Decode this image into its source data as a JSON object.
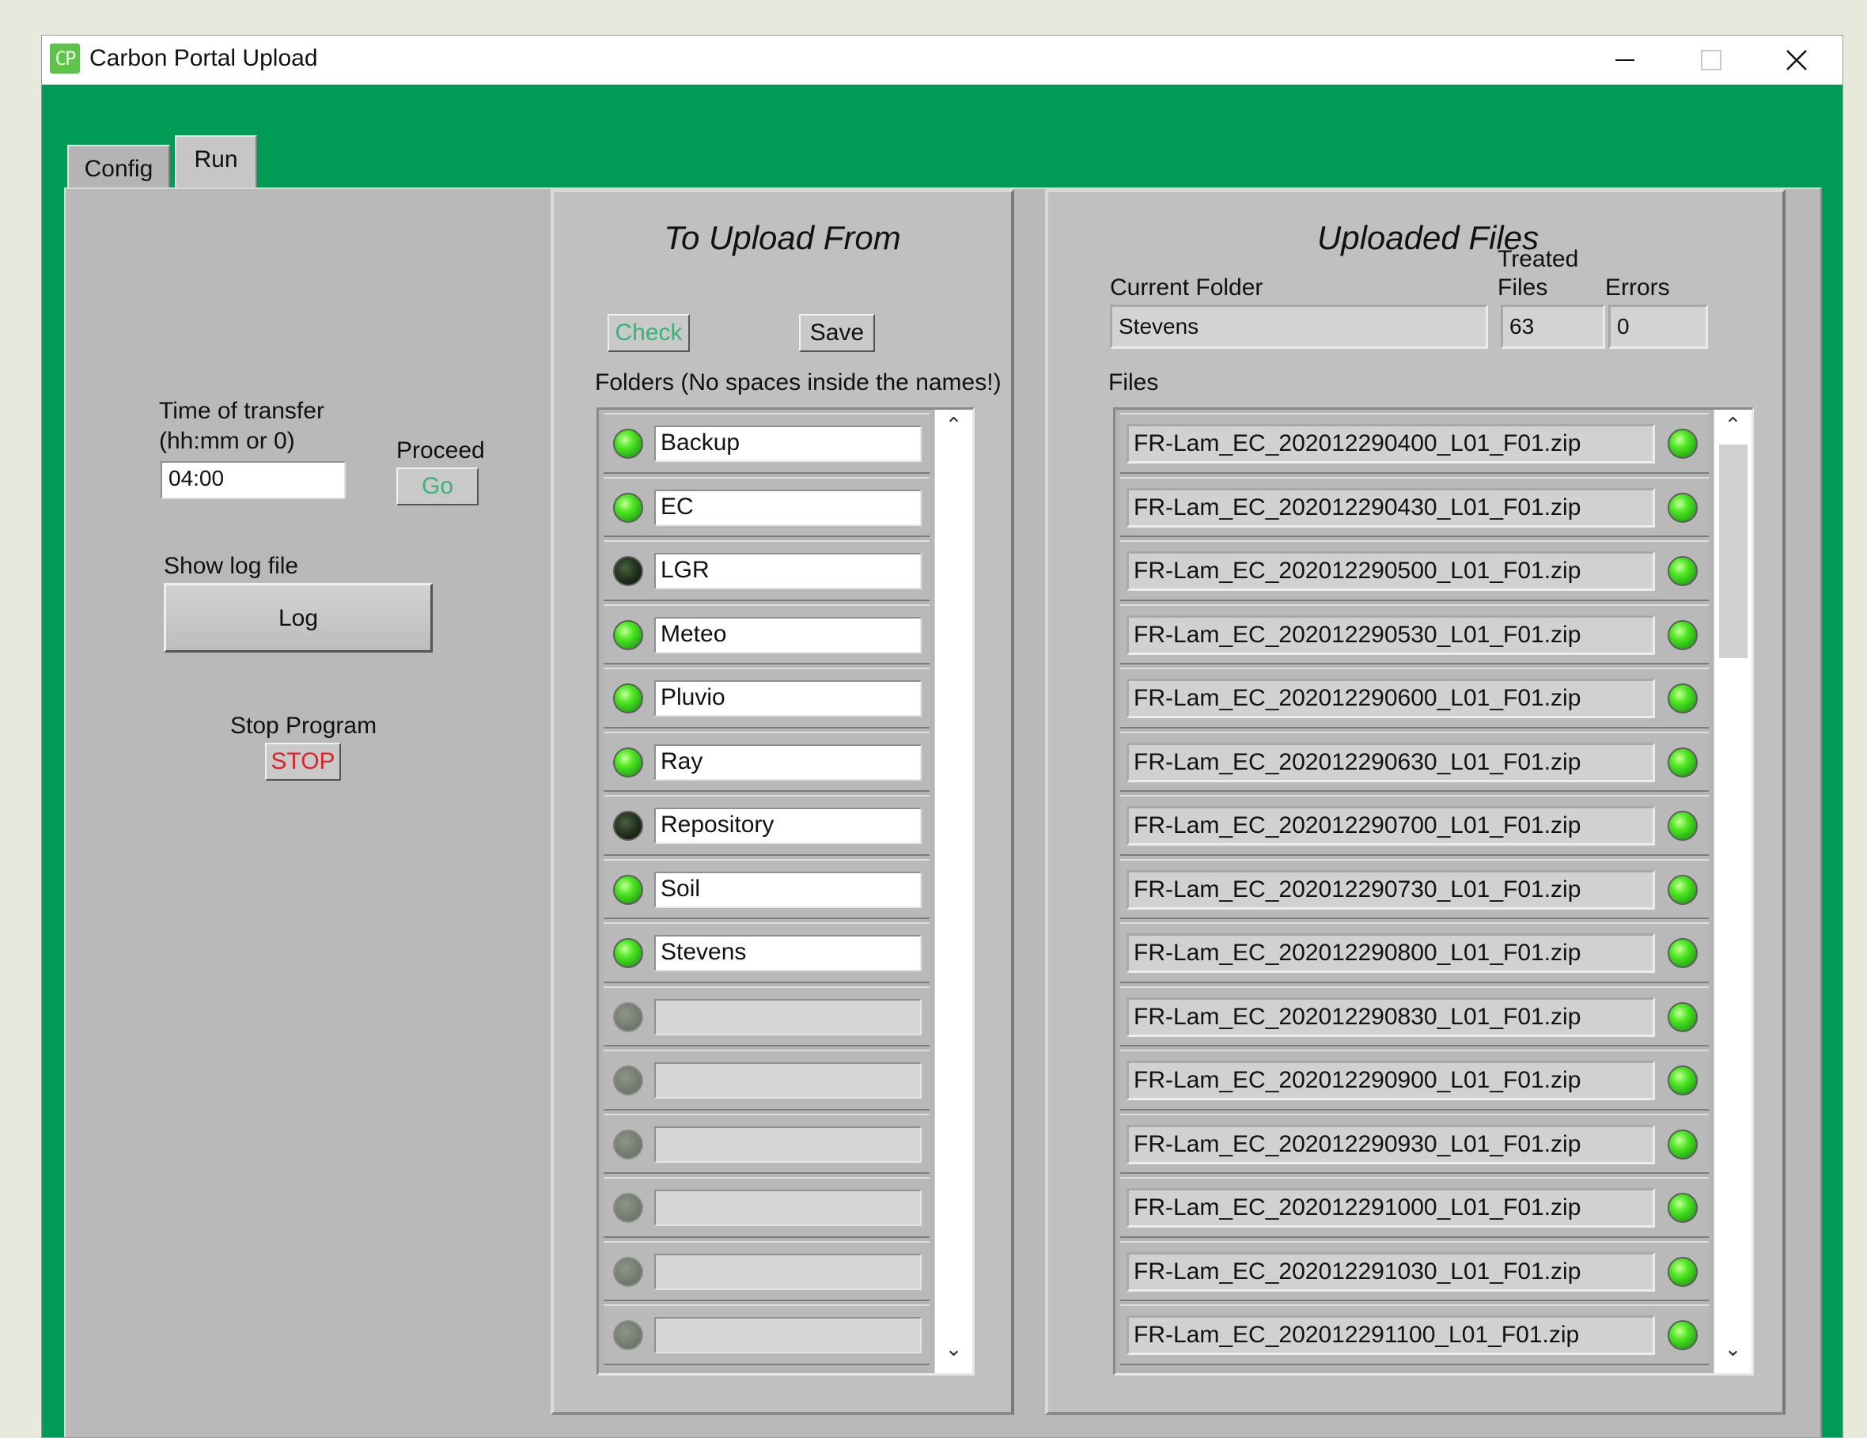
{
  "window": {
    "title": "Carbon Portal Upload",
    "icon_text": "CP",
    "accent": "#009b55"
  },
  "tabs": [
    {
      "label": "Config",
      "active": false
    },
    {
      "label": "Run",
      "active": true
    }
  ],
  "left": {
    "time_label_1": "Time of transfer",
    "time_label_2": "(hh:mm or 0)",
    "time_value": "04:00",
    "proceed_label": "Proceed",
    "go_label": "Go",
    "log_label": "Show log file",
    "log_button": "Log",
    "stop_label": "Stop Program",
    "stop_button": "STOP"
  },
  "upload_from": {
    "title": "To Upload From",
    "check_label": "Check",
    "save_label": "Save",
    "folders_label": "Folders (No spaces inside the names!)",
    "folders": [
      {
        "name": "Backup",
        "status": "on"
      },
      {
        "name": "EC",
        "status": "on"
      },
      {
        "name": "LGR",
        "status": "off"
      },
      {
        "name": "Meteo",
        "status": "on"
      },
      {
        "name": "Pluvio",
        "status": "on"
      },
      {
        "name": "Ray",
        "status": "on"
      },
      {
        "name": "Repository",
        "status": "off"
      },
      {
        "name": "Soil",
        "status": "on"
      },
      {
        "name": "Stevens",
        "status": "on"
      },
      {
        "name": "",
        "status": "empty"
      },
      {
        "name": "",
        "status": "empty"
      },
      {
        "name": "",
        "status": "empty"
      },
      {
        "name": "",
        "status": "empty"
      },
      {
        "name": "",
        "status": "empty"
      },
      {
        "name": "",
        "status": "empty"
      }
    ]
  },
  "uploaded": {
    "title": "Uploaded Files",
    "current_folder_label": "Current Folder",
    "current_folder": "Stevens",
    "treated_label_1": "Treated",
    "treated_label_2": "Files",
    "treated_value": "63",
    "errors_label": "Errors",
    "errors_value": "0",
    "files_label": "Files",
    "files": [
      "FR-Lam_EC_202012290400_L01_F01.zip",
      "FR-Lam_EC_202012290430_L01_F01.zip",
      "FR-Lam_EC_202012290500_L01_F01.zip",
      "FR-Lam_EC_202012290530_L01_F01.zip",
      "FR-Lam_EC_202012290600_L01_F01.zip",
      "FR-Lam_EC_202012290630_L01_F01.zip",
      "FR-Lam_EC_202012290700_L01_F01.zip",
      "FR-Lam_EC_202012290730_L01_F01.zip",
      "FR-Lam_EC_202012290800_L01_F01.zip",
      "FR-Lam_EC_202012290830_L01_F01.zip",
      "FR-Lam_EC_202012290900_L01_F01.zip",
      "FR-Lam_EC_202012290930_L01_F01.zip",
      "FR-Lam_EC_202012291000_L01_F01.zip",
      "FR-Lam_EC_202012291030_L01_F01.zip",
      "FR-Lam_EC_202012291100_L01_F01.zip"
    ]
  },
  "icons": {
    "minimize": "minimize-icon",
    "maximize": "maximize-icon",
    "close": "close-icon",
    "scroll_up": "chevron-up-icon",
    "scroll_down": "chevron-down-icon"
  }
}
